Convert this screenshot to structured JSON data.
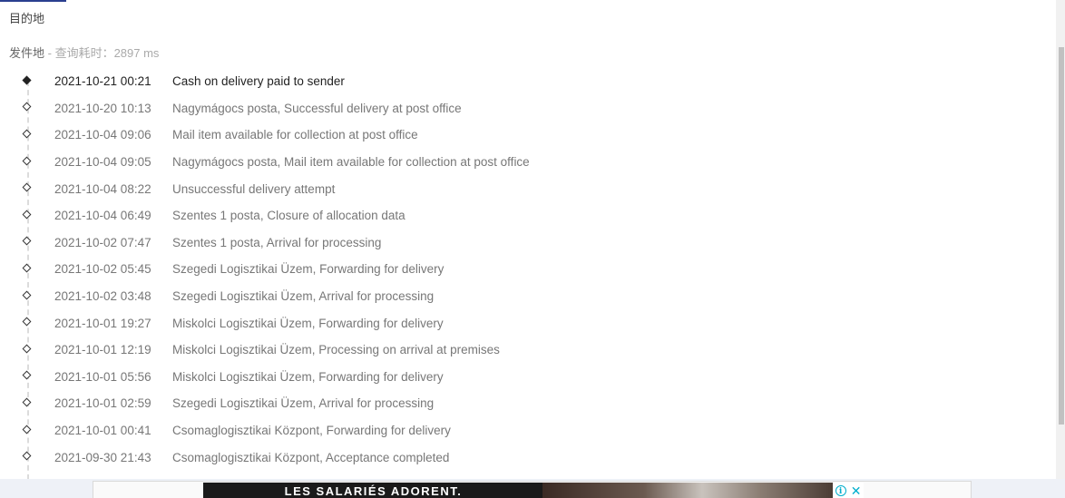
{
  "destination": {
    "label": "目的地"
  },
  "origin": {
    "label": "发件地",
    "query_time": " - 查询耗时：2897 ms"
  },
  "tracking_events": [
    {
      "time": "2021-10-21 00:21",
      "description": "Cash on delivery paid to sender",
      "latest": true
    },
    {
      "time": "2021-10-20 10:13",
      "description": "Nagymágocs posta, Successful delivery at post office"
    },
    {
      "time": "2021-10-04 09:06",
      "description": "Mail item available for collection at post office"
    },
    {
      "time": "2021-10-04 09:05",
      "description": "Nagymágocs posta, Mail item available for collection at post office"
    },
    {
      "time": "2021-10-04 08:22",
      "description": "Unsuccessful delivery attempt"
    },
    {
      "time": "2021-10-04 06:49",
      "description": "Szentes 1 posta, Closure of allocation data"
    },
    {
      "time": "2021-10-02 07:47",
      "description": "Szentes 1 posta, Arrival for processing"
    },
    {
      "time": "2021-10-02 05:45",
      "description": "Szegedi Logisztikai Üzem, Forwarding for delivery"
    },
    {
      "time": "2021-10-02 03:48",
      "description": "Szegedi Logisztikai Üzem, Arrival for processing"
    },
    {
      "time": "2021-10-01 19:27",
      "description": "Miskolci Logisztikai Üzem, Forwarding for delivery"
    },
    {
      "time": "2021-10-01 12:19",
      "description": "Miskolci Logisztikai Üzem, Processing on arrival at premises"
    },
    {
      "time": "2021-10-01 05:56",
      "description": "Miskolci Logisztikai Üzem, Forwarding for delivery"
    },
    {
      "time": "2021-10-01 02:59",
      "description": "Szegedi Logisztikai Üzem, Arrival for processing"
    },
    {
      "time": "2021-10-01 00:41",
      "description": "Csomaglogisztikai Központ, Forwarding for delivery"
    },
    {
      "time": "2021-09-30 21:43",
      "description": "Csomaglogisztikai Központ, Acceptance completed"
    }
  ],
  "ad": {
    "headline": "LES SALARIÉS ADORENT.",
    "info_icon": "i",
    "close_icon": "✕"
  },
  "colors": {
    "accent": "#2a3f8f",
    "latest_text": "#222222",
    "event_text": "#777777",
    "ad_icon": "#00aecd"
  }
}
